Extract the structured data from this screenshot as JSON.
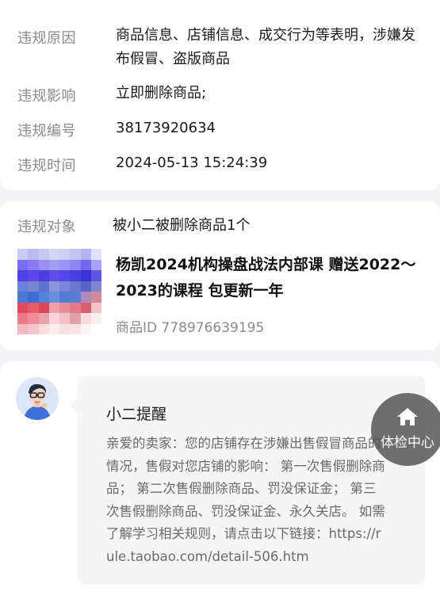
{
  "violation_info": {
    "rows": [
      {
        "label": "违规原因",
        "value": "商品信息、店铺信息、成交行为等表明，涉嫌发布假冒、盗版商品"
      },
      {
        "label": "违规影响",
        "value": "立即删除商品;"
      },
      {
        "label": "违规编号",
        "value": "38173920634"
      },
      {
        "label": "违规时间",
        "value": "2024-05-13 15:24:39"
      }
    ]
  },
  "target": {
    "label": "违规对象",
    "summary": "被小二被删除商品1个",
    "product_title": "杨凯2024机构操盘战法内部课  赠送2022～2023的课程  包更新一年",
    "product_id": "商品ID 778976639195"
  },
  "message": {
    "title": "小二提醒",
    "body": "亲爱的卖家：您的店铺存在涉嫌出售假冒商品的情况，售假对您店铺的影响： 第一次售假删除商品； 第二次售假删除商品、罚没保证金； 第三次售假删除商品、罚没保证金、永久关店。 如需了解学习相关规则，请点击以下链接：https://rule.taobao.com/detail-506.htm"
  },
  "float_button": {
    "label": "体检中心",
    "icon": "home-icon"
  }
}
